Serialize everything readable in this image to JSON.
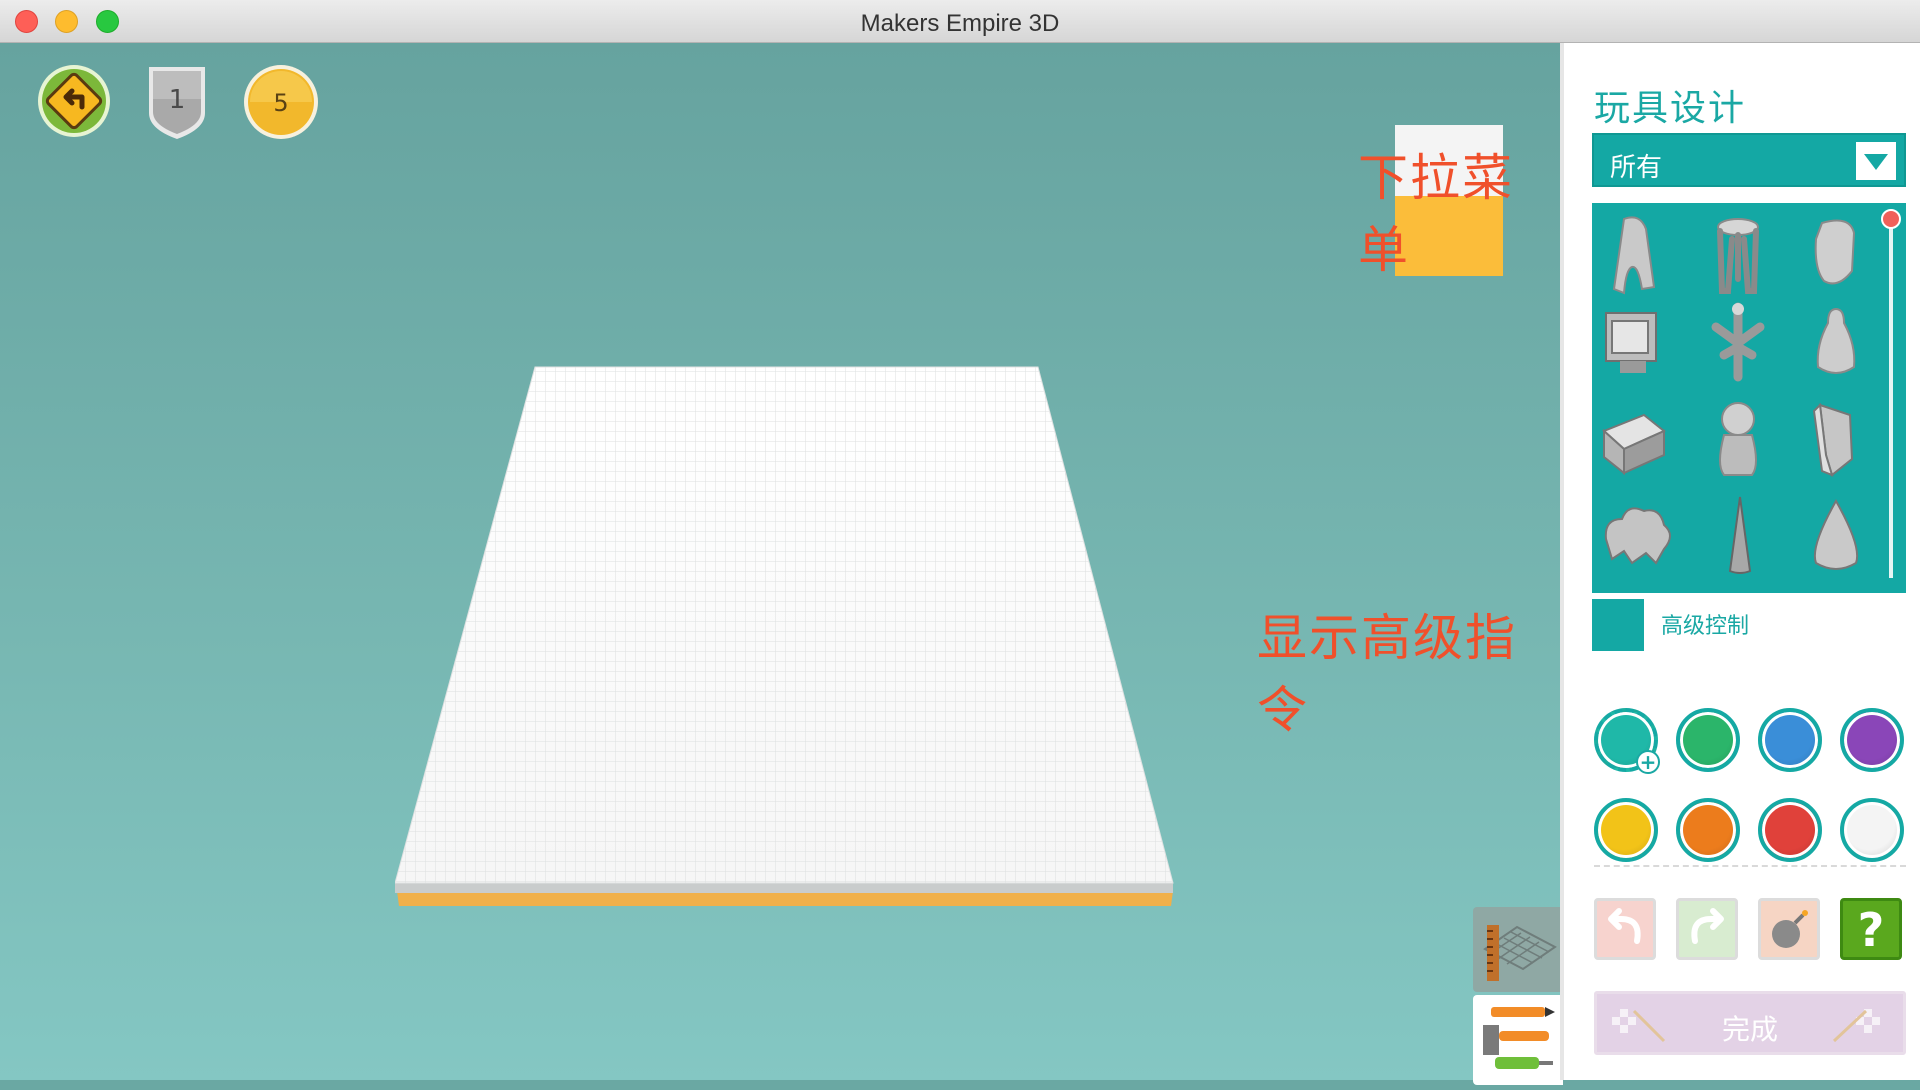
{
  "window": {
    "title": "Makers Empire 3D"
  },
  "hud": {
    "level_badge": "1",
    "coins": "5"
  },
  "annotations": {
    "dropdown_note": "下拉菜单",
    "advanced_note": "显示高级指令"
  },
  "panel": {
    "title": "玩具设计",
    "category_dropdown": {
      "selected": "所有"
    },
    "shapes": [
      {
        "name": "arch"
      },
      {
        "name": "stool"
      },
      {
        "name": "egg"
      },
      {
        "name": "screen-box"
      },
      {
        "name": "branch-stand"
      },
      {
        "name": "pawn"
      },
      {
        "name": "cube"
      },
      {
        "name": "figure-head"
      },
      {
        "name": "wedge-block"
      },
      {
        "name": "cloud-blob"
      },
      {
        "name": "spike"
      },
      {
        "name": "drop"
      }
    ],
    "advanced_control_label": "高级控制",
    "colors": [
      {
        "name": "teal-custom",
        "hex": "#1fb8a8",
        "selected": true
      },
      {
        "name": "green",
        "hex": "#2bb56a"
      },
      {
        "name": "blue",
        "hex": "#3a8ed8"
      },
      {
        "name": "purple",
        "hex": "#8a46b8"
      },
      {
        "name": "yellow",
        "hex": "#f2c318"
      },
      {
        "name": "orange",
        "hex": "#ec7c1c"
      },
      {
        "name": "red",
        "hex": "#e0413a"
      },
      {
        "name": "white",
        "hex": "#f4f4f4"
      }
    ],
    "done_label": "完成",
    "help_label": "?"
  }
}
